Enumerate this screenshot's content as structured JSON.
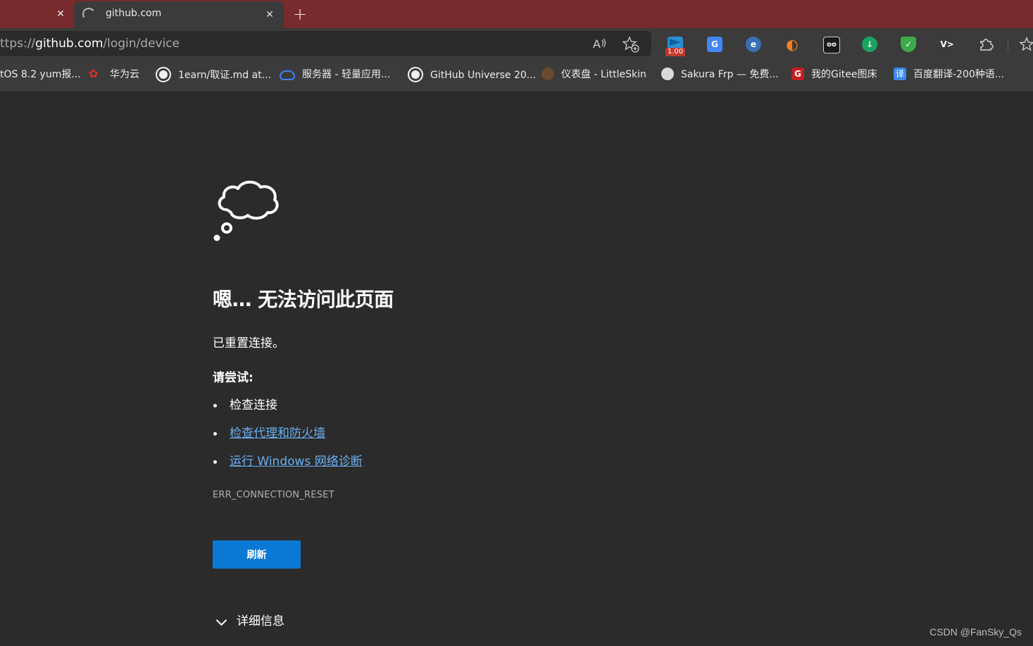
{
  "tabs": [
    {
      "title": "",
      "close_icon": "✕"
    },
    {
      "title": "github.com",
      "close_icon": "✕",
      "loading": true
    }
  ],
  "new_tab_icon": "+",
  "address_bar": {
    "scheme": "ttps://",
    "host": "github.com",
    "path": "/login/device"
  },
  "extensions": [
    {
      "name": "speed-extension",
      "color": "#2a8fd4",
      "badge": "1.00"
    },
    {
      "name": "translate-extension",
      "color": "#4285f4",
      "glyph": "G"
    },
    {
      "name": "ublock-extension",
      "color": "#3a6fb5",
      "glyph": "e"
    },
    {
      "name": "dark-reader-extension",
      "color": "#f4801f",
      "glyph": "◐"
    },
    {
      "name": "tampermonkey-extension",
      "color": "#444444",
      "glyph": "oo"
    },
    {
      "name": "download-extension",
      "color": "#1aa260",
      "glyph": "↓"
    },
    {
      "name": "shield-extension",
      "color": "#3daa4a",
      "glyph": "✓"
    },
    {
      "name": "vpn-extension",
      "color": "#3b3b3b",
      "glyph": "V>"
    }
  ],
  "bookmarks": [
    {
      "label": "tOS 8.2 yum报...",
      "icon": "none"
    },
    {
      "label": "华为云",
      "icon": "huawei-icon",
      "color": "#e32d2d"
    },
    {
      "label": "1earn/取证.md at...",
      "icon": "github-icon",
      "color": "#f0f0f0"
    },
    {
      "label": "服务器 - 轻量应用...",
      "icon": "cloud-icon",
      "color": "#3b82f6"
    },
    {
      "label": "GitHub Universe 20...",
      "icon": "github-icon",
      "color": "#f0f0f0"
    },
    {
      "label": "仪表盘 - LittleSkin",
      "icon": "skin-icon",
      "color": "#6b4a2e"
    },
    {
      "label": "Sakura Frp — 免费...",
      "icon": "sakura-icon",
      "color": "#d9d9d9"
    },
    {
      "label": "我的Gitee图床",
      "icon": "gitee-icon",
      "color": "#c71d23"
    },
    {
      "label": "百度翻译-200种语...",
      "icon": "baidu-fanyi-icon",
      "color": "#3c8af0"
    }
  ],
  "error_page": {
    "heading": "嗯… 无法访问此页面",
    "subtitle": "已重置连接。",
    "try_label": "请尝试:",
    "suggestions": [
      {
        "text": "检查连接",
        "link": false
      },
      {
        "text": "检查代理和防火墙",
        "link": true
      },
      {
        "text": "运行 Windows 网络诊断",
        "link": true
      }
    ],
    "error_code": "ERR_CONNECTION_RESET",
    "refresh_label": "刷新",
    "details_label": "详细信息"
  },
  "watermark": "CSDN @FanSky_Qs",
  "colors": {
    "tabstrip": "#772b2d",
    "toolbar": "#3b3b3b",
    "page_bg": "#2b2b2b",
    "link": "#6ab0f3",
    "button": "#0b78d4"
  }
}
